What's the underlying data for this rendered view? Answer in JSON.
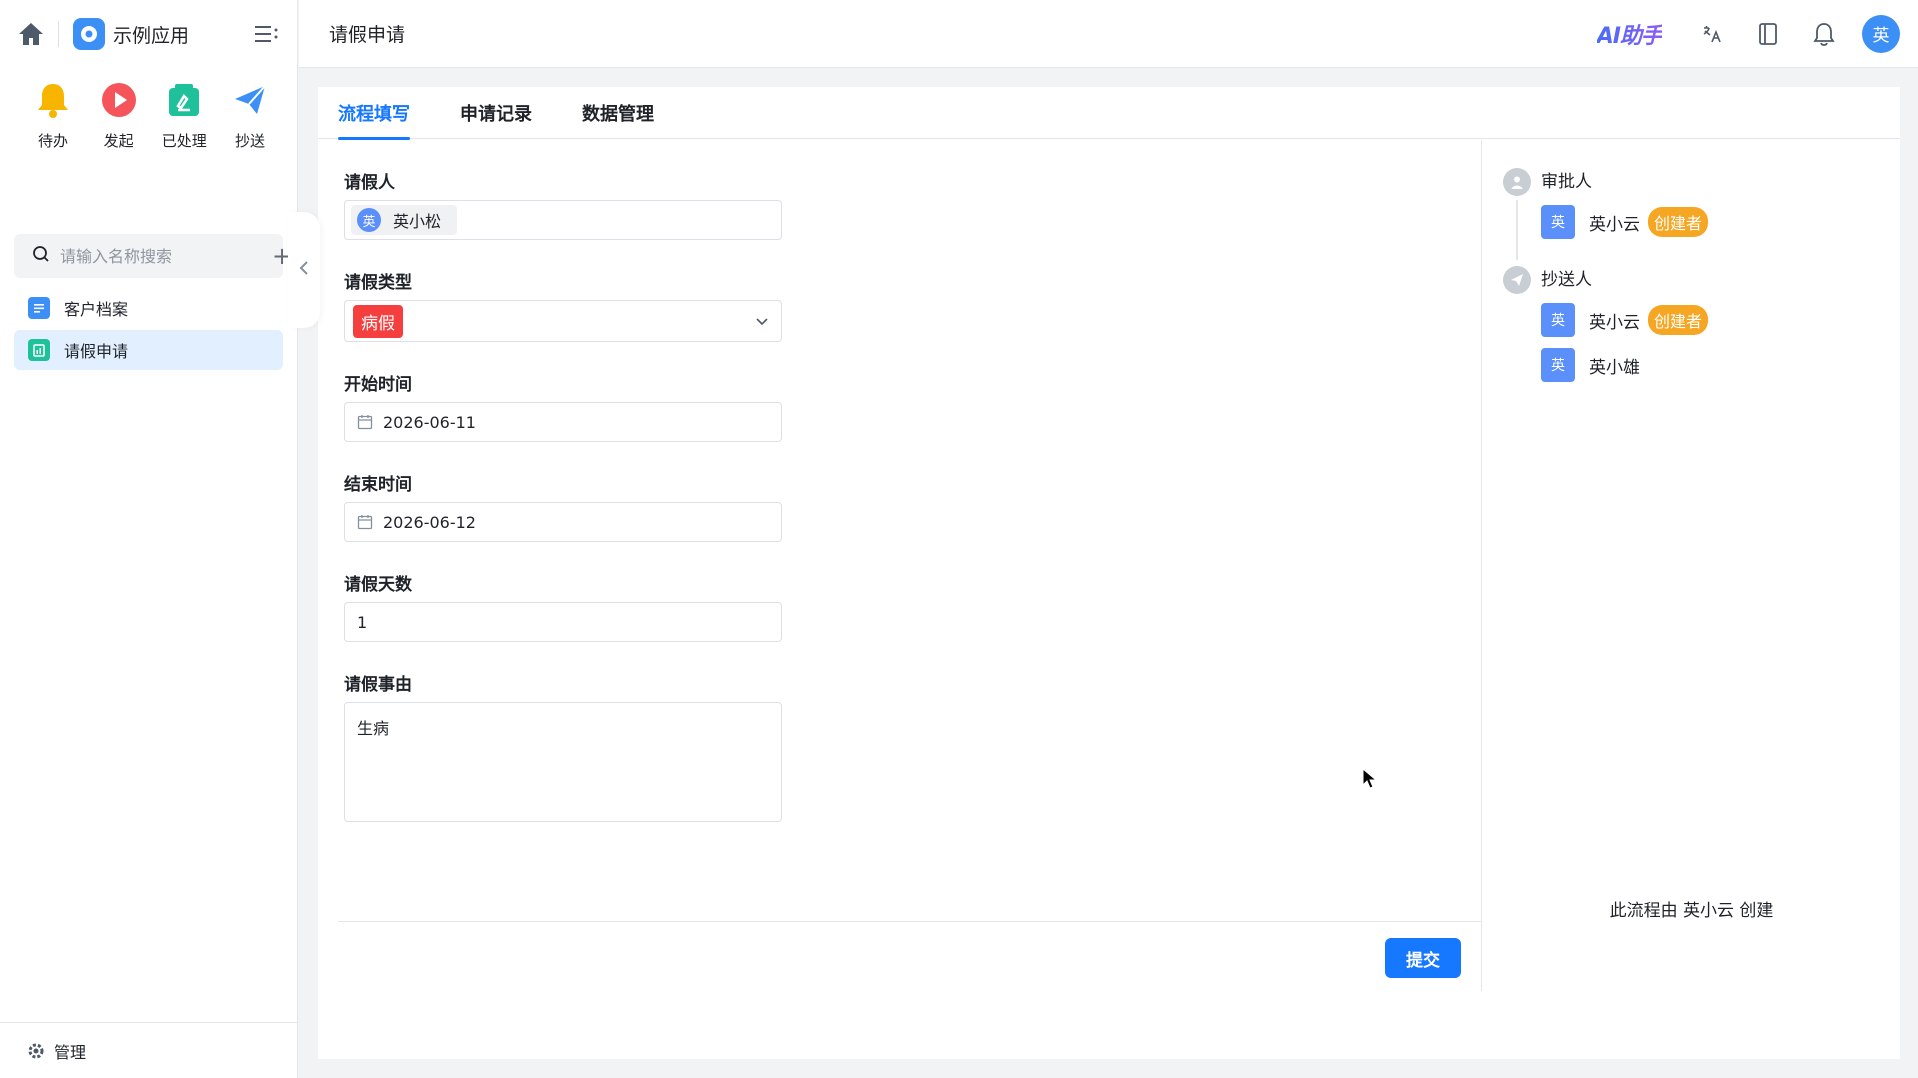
{
  "app": {
    "name": "示例应用"
  },
  "quick": [
    {
      "label": "待办"
    },
    {
      "label": "发起"
    },
    {
      "label": "已处理"
    },
    {
      "label": "抄送"
    }
  ],
  "search": {
    "placeholder": "请输入名称搜索"
  },
  "nav": [
    {
      "label": "客户档案"
    },
    {
      "label": "请假申请"
    }
  ],
  "footer": {
    "label": "管理"
  },
  "topbar": {
    "title": "请假申请",
    "ai_label": "AI助手",
    "avatar_initial": "英"
  },
  "tabs": [
    {
      "label": "流程填写"
    },
    {
      "label": "申请记录"
    },
    {
      "label": "数据管理"
    }
  ],
  "form": {
    "applicant": {
      "label": "请假人",
      "avatar_initial": "英",
      "value": "英小松"
    },
    "leave_type": {
      "label": "请假类型",
      "value": "病假"
    },
    "start": {
      "label": "开始时间",
      "value": "2026-06-11"
    },
    "end": {
      "label": "结束时间",
      "value": "2026-06-12"
    },
    "days": {
      "label": "请假天数",
      "value": "1"
    },
    "reason": {
      "label": "请假事由",
      "value": "生病"
    },
    "submit_label": "提交"
  },
  "flow": {
    "approver": {
      "title": "审批人",
      "people": [
        {
          "initial": "英",
          "name": "英小云",
          "tag": "创建者"
        }
      ]
    },
    "cc": {
      "title": "抄送人",
      "people": [
        {
          "initial": "英",
          "name": "英小云",
          "tag": "创建者"
        },
        {
          "initial": "英",
          "name": "英小雄"
        }
      ]
    },
    "created_by": "此流程由 英小云 创建"
  },
  "colors": {
    "primary": "#1677ff",
    "tag_red": "#f53f3f",
    "creator": "#f5a623"
  }
}
